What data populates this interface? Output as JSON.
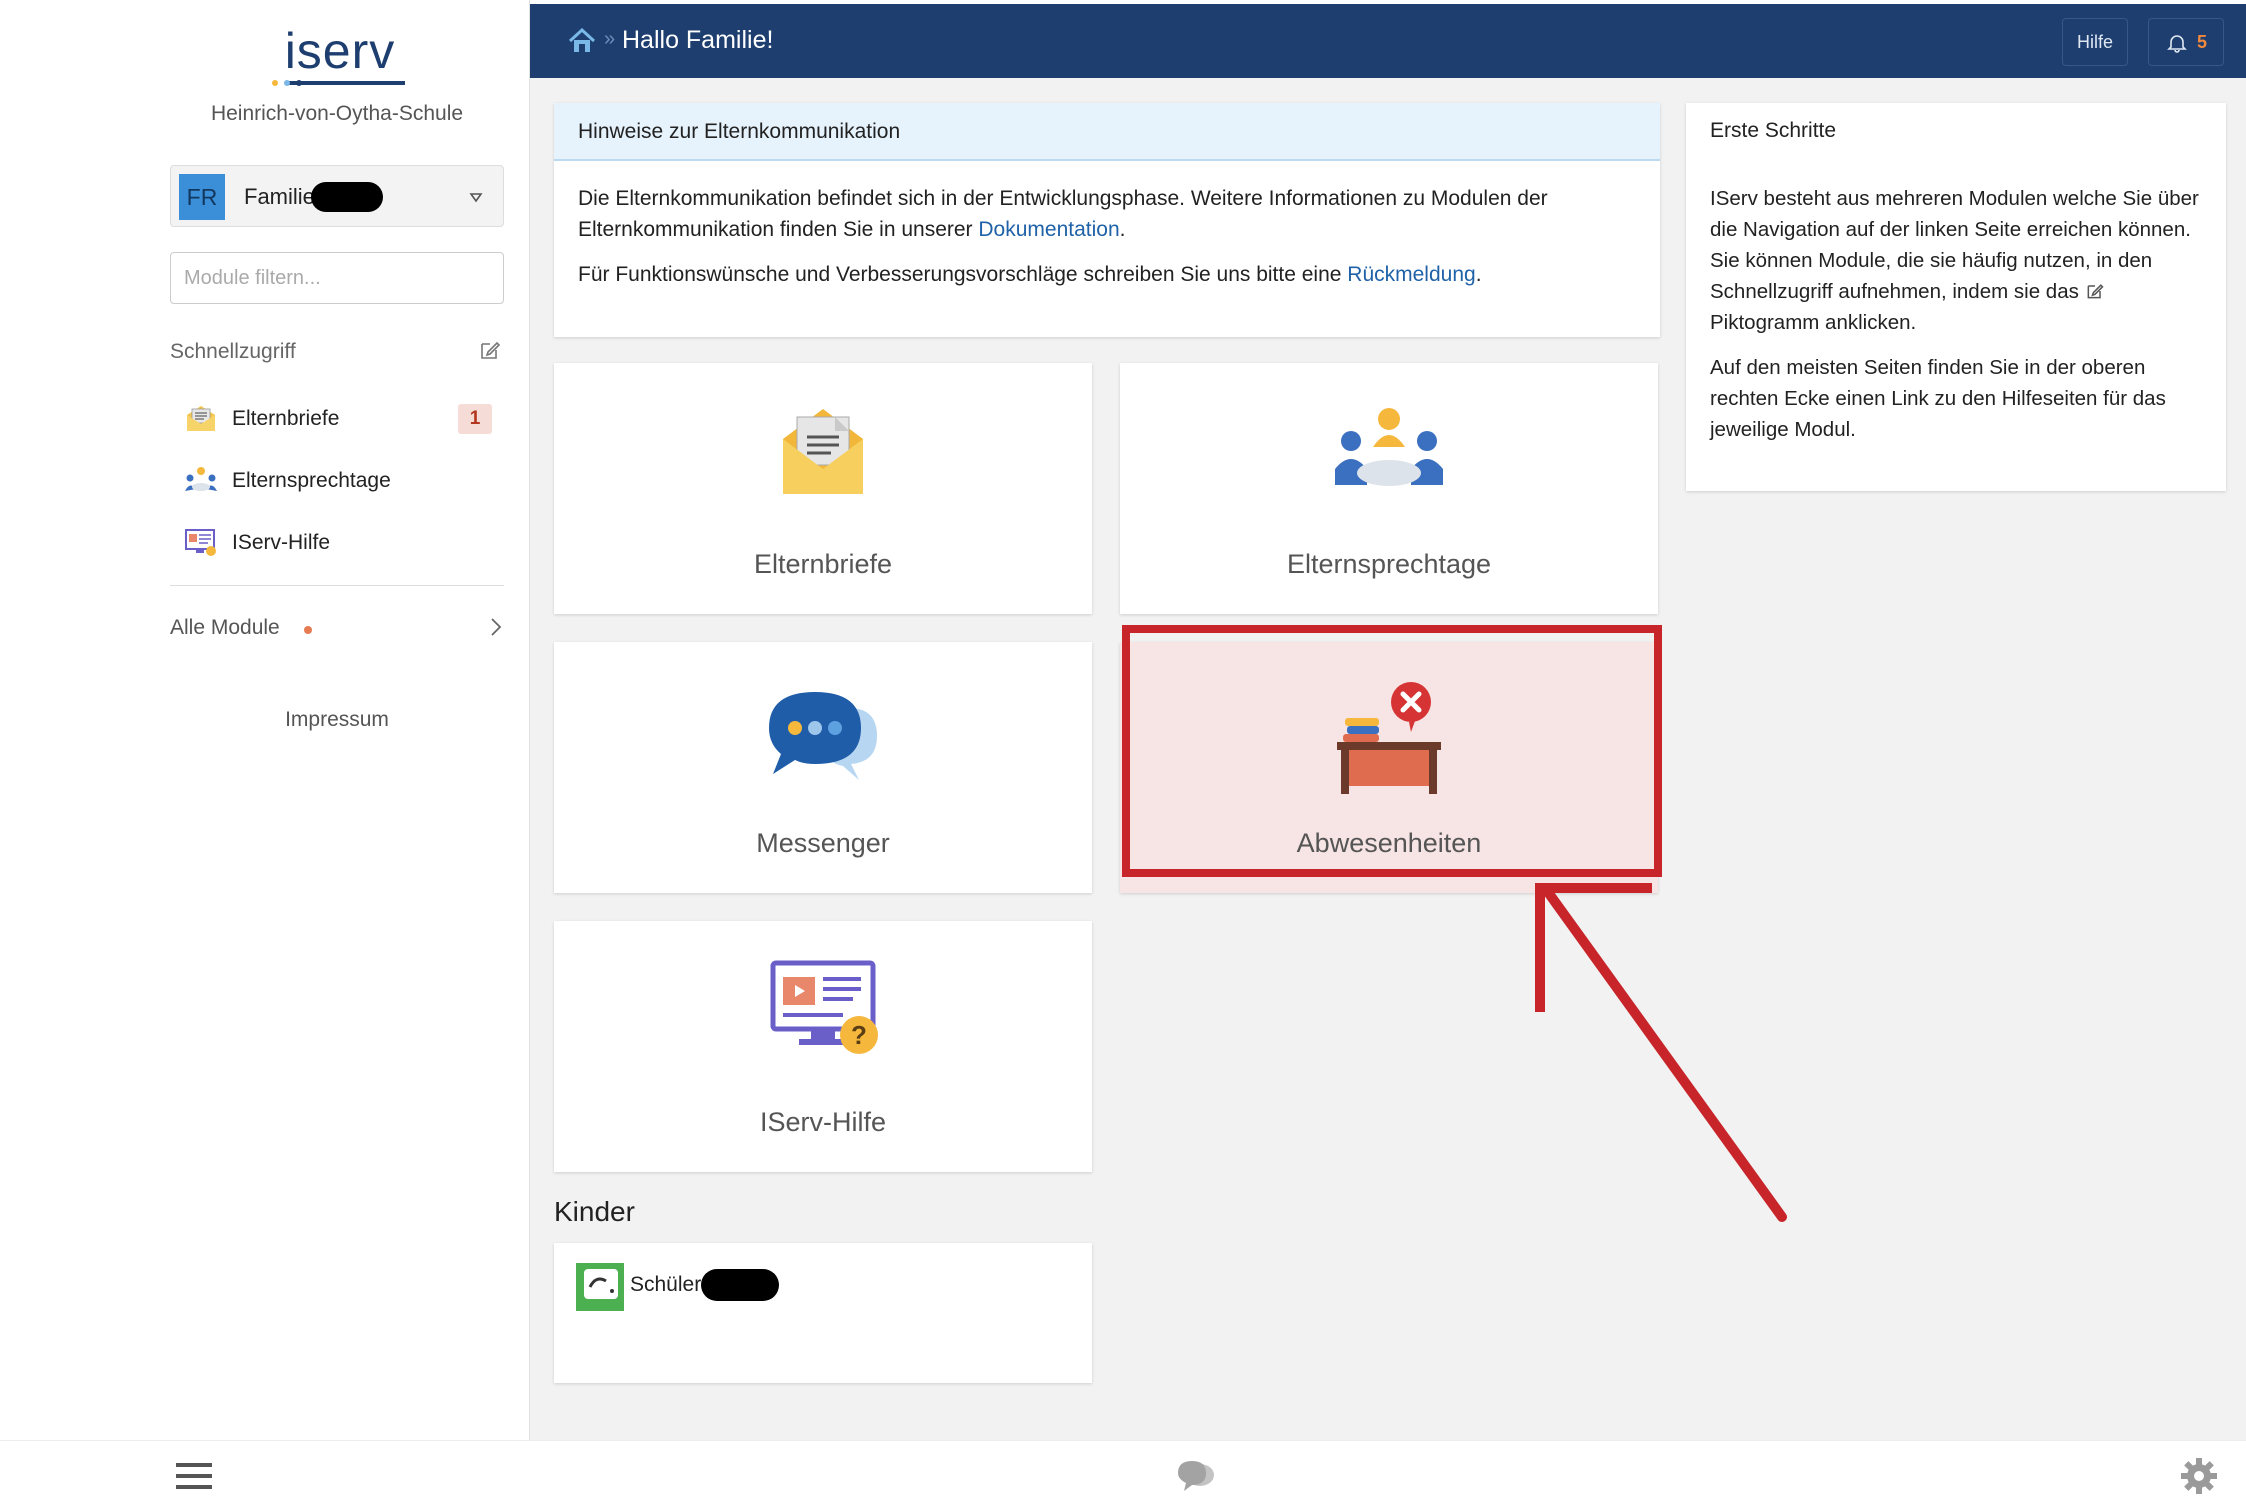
{
  "app": {
    "logo_text": "iserv",
    "school": "Heinrich-von-Oytha-Schule"
  },
  "user": {
    "initials": "FR",
    "name": "Familie"
  },
  "sidebar": {
    "filter_placeholder": "Module filtern...",
    "quick_title": "Schnellzugriff",
    "quick_items": [
      {
        "label": "Elternbriefe",
        "badge": "1",
        "icon": "envelope-letter-icon"
      },
      {
        "label": "Elternsprechtage",
        "icon": "meeting-people-icon"
      },
      {
        "label": "IServ-Hilfe",
        "icon": "help-screen-icon"
      }
    ],
    "all_modules": "Alle Module",
    "impressum": "Impressum"
  },
  "topbar": {
    "separator": "»",
    "greeting": "Hallo Familie!",
    "help": "Hilfe",
    "notifications": "5"
  },
  "notice": {
    "title": "Hinweise zur Elternkommunikation",
    "p1_text": "Die Elternkommunikation befindet sich in der Entwicklungsphase. Weitere Informationen zu Modulen der Elternkommunikation finden Sie in unserer ",
    "p1_link": "Dokumentation",
    "p1_end": ".",
    "p2_text": "Für Funktionswünsche und Verbesserungsvorschläge schreiben Sie uns bitte eine ",
    "p2_link": "Rückmeldung",
    "p2_end": "."
  },
  "steps": {
    "title": "Erste Schritte",
    "p1_a": "IServ besteht aus mehreren Modulen welche Sie über die Navigation auf der linken Seite erreichen können. Sie können Module, die sie häufig nutzen, in den Schnellzugriff aufnehmen, indem sie das ",
    "p1_b": " Piktogramm anklicken.",
    "p2": "Auf den meisten Seiten finden Sie in der oberen rechten Ecke einen Link zu den Hilfeseiten für das jeweilige Modul."
  },
  "tiles": [
    {
      "label": "Elternbriefe",
      "icon": "envelope-letter-icon"
    },
    {
      "label": "Elternsprechtage",
      "icon": "meeting-people-icon"
    },
    {
      "label": "Messenger",
      "icon": "chat-bubbles-icon"
    },
    {
      "label": "Abwesenheiten",
      "icon": "desk-absence-icon",
      "highlighted": true
    },
    {
      "label": "IServ-Hilfe",
      "icon": "help-screen-icon"
    }
  ],
  "kinder": {
    "title": "Kinder",
    "children": [
      {
        "name": "Schüler"
      }
    ]
  },
  "colors": {
    "topbar": "#1d3e6e",
    "highlight": "#c8252b",
    "link": "#1f62a8",
    "brand": "#1d3e6e"
  }
}
